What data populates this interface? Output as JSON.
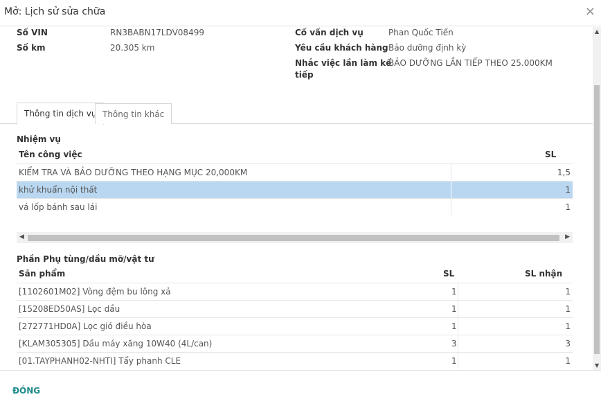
{
  "dialog": {
    "title": "Mở: Lịch sử sửa chữa",
    "close_glyph": "×"
  },
  "info": {
    "vin_label": "Số VIN",
    "vin_value": "RN3BABN17LDV08499",
    "km_label": "Số km",
    "km_value": "20.305 km",
    "advisor_label": "Cố vấn dịch vụ",
    "advisor_value": "Phan Quốc Tiến",
    "request_label": "Yêu cầu khách hàng",
    "request_value": "Bảo dưỡng định kỳ",
    "reminder_label_1": "Nhắc việc lần làm kế",
    "reminder_label_2": "tiếp",
    "reminder_value": "BẢO DƯỠNG LẦN TIẾP THEO 25.000KM"
  },
  "tabs": [
    {
      "label": "Thông tin dịch vụ",
      "active": true
    },
    {
      "label": "Thông tin khác",
      "active": false
    }
  ],
  "tasks": {
    "section_title": "Nhiệm vụ",
    "col_name": "Tên công việc",
    "col_qty": "SL",
    "rows": [
      {
        "name": "KIỂM TRA VÀ BẢO DƯỠNG THEO HẠNG MỤC 20,000KM",
        "qty": "1,5"
      },
      {
        "name": "khử khuẩn nội thất",
        "qty": "1"
      },
      {
        "name": "vá lốp bánh sau lái",
        "qty": "1"
      }
    ]
  },
  "parts": {
    "section_title": "Phần Phụ tùng/dầu mỡ/vật tư",
    "col_product": "Sản phẩm",
    "col_qty": "SL",
    "col_received": "SL nhận",
    "rows": [
      {
        "product": "[1102601M02] Vòng đệm bu lông xả",
        "qty": "1",
        "received": "1"
      },
      {
        "product": "[15208ED50AS] Lọc dầu",
        "qty": "1",
        "received": "1"
      },
      {
        "product": "[272771HD0A] Lọc gió điều hòa",
        "qty": "1",
        "received": "1"
      },
      {
        "product": "[KLAM305305] Dầu máy xăng 10W40 (4L/can)",
        "qty": "3",
        "received": "3"
      },
      {
        "product": "[01.TAYPHANH02-NHTI] Tẩy phanh CLE",
        "qty": "1",
        "received": "1"
      }
    ]
  },
  "footer": {
    "close_label": "ĐÓNG"
  }
}
